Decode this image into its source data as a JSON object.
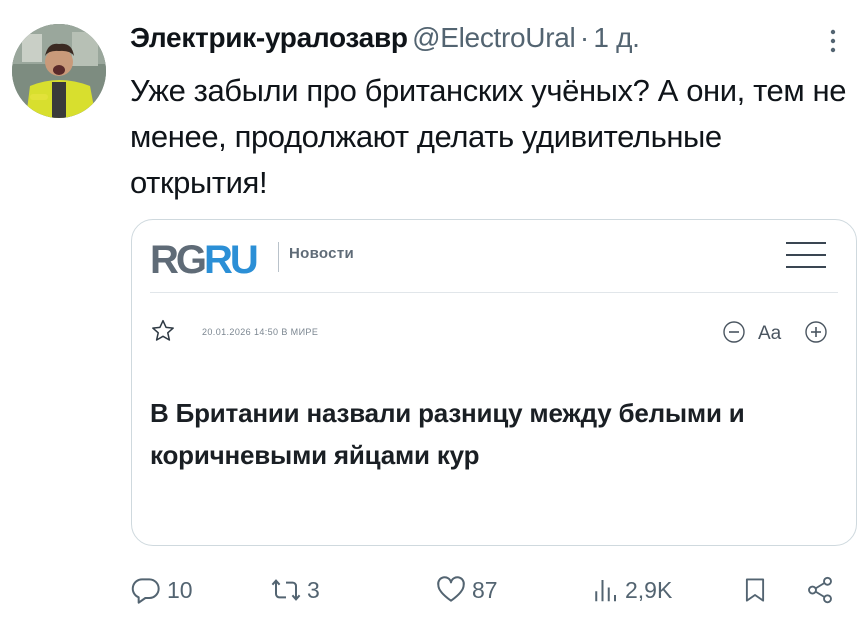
{
  "post": {
    "author_name": "Электрик-уралозавр",
    "handle": "@ElectroUral",
    "separator": "·",
    "time": "1 д.",
    "text": "Уже забыли про британских учёных? А они, тем не менее, продолжают делать удивительные открытия!"
  },
  "card": {
    "logo_left": "RG",
    "logo_right": "RU",
    "section": "Новости",
    "meta": "20.01.2026 14:50 В МИРЕ",
    "font_control_label": "Aa",
    "headline": "В Британии назвали разницу между белыми и коричневыми яйцами кур"
  },
  "actions": {
    "replies": "10",
    "reposts": "3",
    "likes": "87",
    "views": "2,9K"
  },
  "colors": {
    "text": "#0f1419",
    "secondary": "#536471",
    "border": "#cfd9de",
    "logo_blue": "#2b8fd6"
  }
}
